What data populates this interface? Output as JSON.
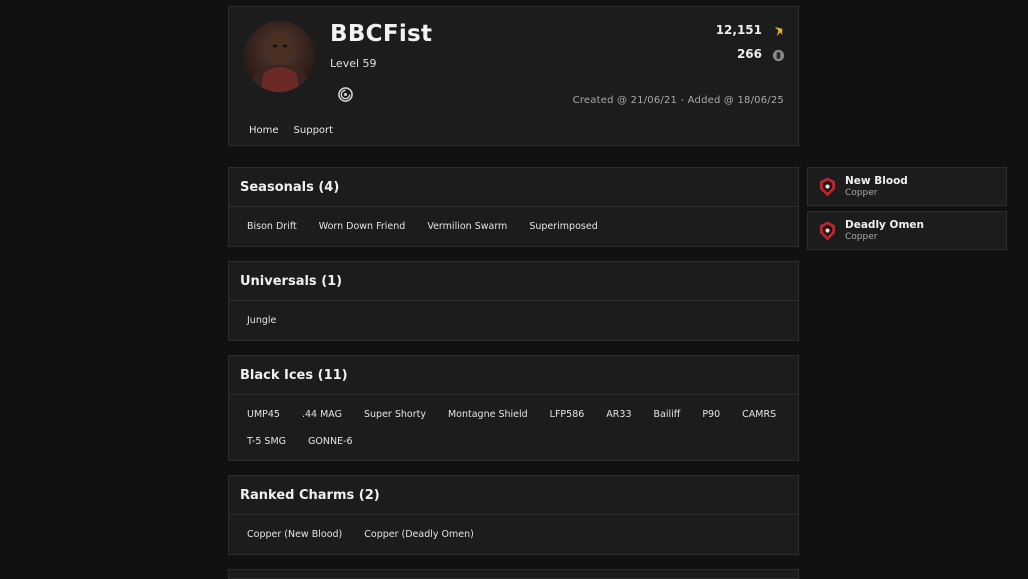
{
  "profile": {
    "username": "BBCFist",
    "level": "Level 59",
    "renown": "12,151",
    "credits": "266",
    "created_text": "Created @ 21/06/21 - Added @ 18/06/25",
    "nav": [
      {
        "label": "Home"
      },
      {
        "label": "Support"
      }
    ],
    "icons": {
      "avatar": "avatar-image",
      "platform": "ubisoft-icon",
      "renown": "renown-icon",
      "credits": "r6-credits-icon"
    }
  },
  "sections": [
    {
      "title": "Seasonals (4)",
      "items": [
        "Bison Drift",
        "Worn Down Friend",
        "Vermilion Swarm",
        "Superimposed"
      ]
    },
    {
      "title": "Universals (1)",
      "items": [
        "Jungle"
      ]
    },
    {
      "title": "Black Ices (11)",
      "items": [
        "UMP45",
        ".44 MAG",
        "Super Shorty",
        "Montagne Shield",
        "LFP586",
        "AR33",
        "Bailiff",
        "P90",
        "CAMRS",
        "T-5 SMG",
        "GONNE-6"
      ]
    },
    {
      "title": "Ranked Charms (2)",
      "items": [
        "Copper (New Blood)",
        "Copper (Deadly Omen)"
      ]
    }
  ],
  "ranks": [
    {
      "season": "New Blood",
      "tier": "Copper",
      "icon": "copper-rank-icon"
    },
    {
      "season": "Deadly Omen",
      "tier": "Copper",
      "icon": "copper-rank-icon"
    }
  ],
  "colors": {
    "background": "#111112",
    "panel": "#1c1c1d",
    "border": "#2d2d2f",
    "renown_gold": "#e0b42a",
    "rank_red": "#b52a2f"
  }
}
